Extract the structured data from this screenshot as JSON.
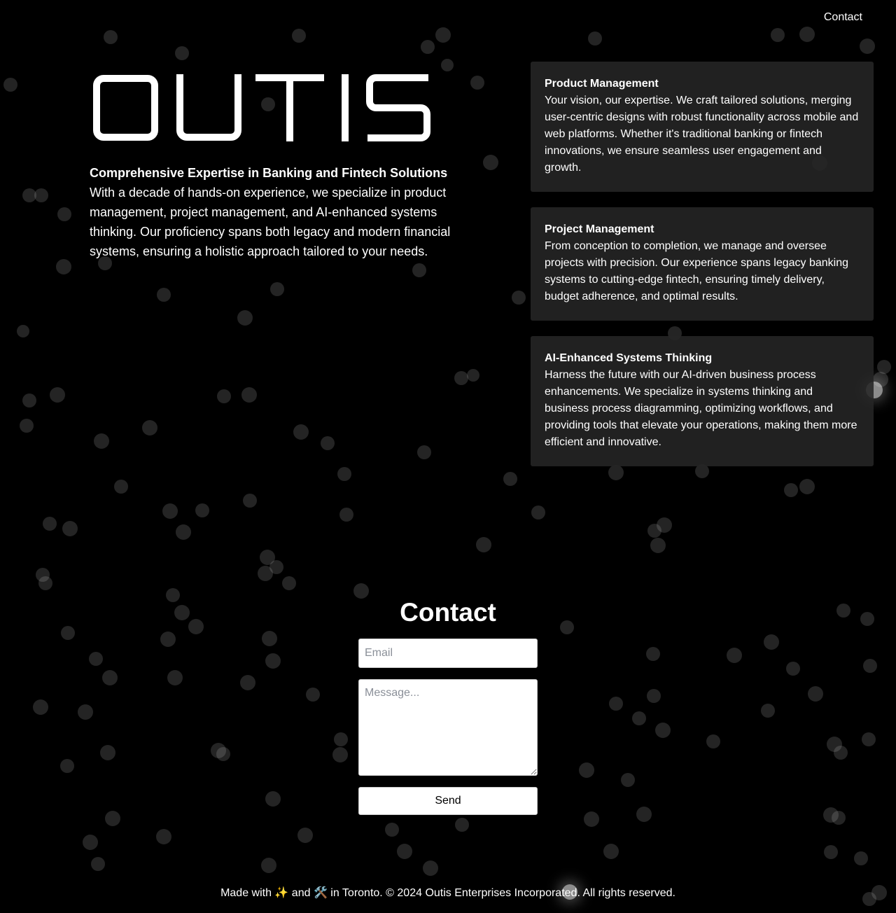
{
  "nav": {
    "contact_label": "Contact"
  },
  "hero": {
    "logo_text": "OUTIS",
    "heading": "Comprehensive Expertise in Banking and Fintech Solutions",
    "body": "With a decade of hands-on experience, we specialize in product management, project management, and AI-enhanced systems thinking. Our proficiency spans both legacy and modern financial systems, ensuring a holistic approach tailored to your needs."
  },
  "services": [
    {
      "title": "Product Management",
      "body": "Your vision, our expertise. We craft tailored solutions, merging user-centric designs with robust functionality across mobile and web platforms. Whether it's traditional banking or fintech innovations, we ensure seamless user engagement and growth."
    },
    {
      "title": "Project Management",
      "body": "From conception to completion, we manage and oversee projects with precision. Our experience spans legacy banking systems to cutting-edge fintech, ensuring timely delivery, budget adherence, and optimal results."
    },
    {
      "title": "AI-Enhanced Systems Thinking",
      "body": "Harness the future with our AI-driven business process enhancements. We specialize in systems thinking and business process diagramming, optimizing workflows, and providing tools that elevate your operations, making them more efficient and innovative."
    }
  ],
  "contact": {
    "title": "Contact",
    "email_placeholder": "Email",
    "email_value": "",
    "message_placeholder": "Message...",
    "message_value": "",
    "send_label": "Send"
  },
  "footer": {
    "text": "Made with ✨ and 🛠️ in Toronto. © 2024 Outis Enterprises Incorporated. All rights reserved."
  },
  "colors": {
    "background": "#000000",
    "text": "#ffffff",
    "card_background": "#262626"
  }
}
